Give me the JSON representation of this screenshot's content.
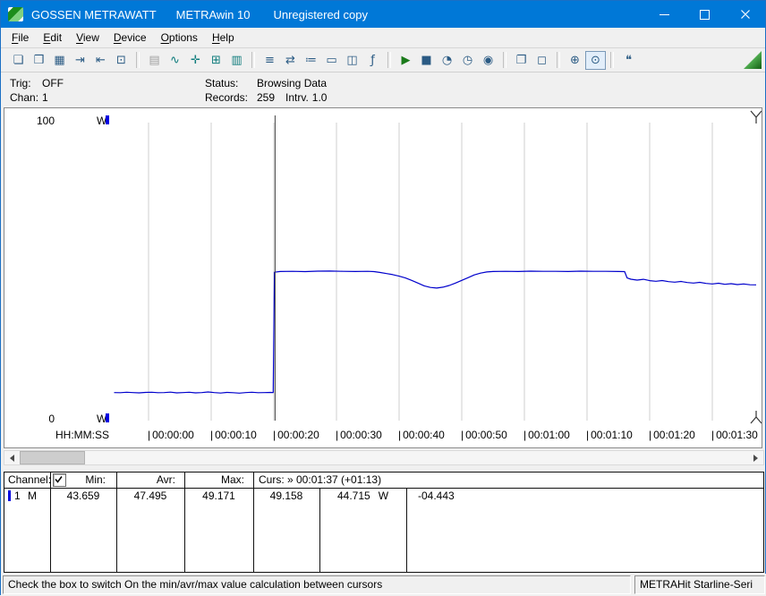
{
  "titlebar": {
    "app": "GOSSEN METRAWATT",
    "product": "METRAwin 10",
    "license": "Unregistered copy"
  },
  "menu": {
    "items": [
      "File",
      "Edit",
      "View",
      "Device",
      "Options",
      "Help"
    ]
  },
  "toolbar": {
    "buttons": [
      {
        "name": "new-file",
        "glyph": "❏"
      },
      {
        "name": "open-file",
        "glyph": "❒"
      },
      {
        "name": "save-file",
        "glyph": "▦"
      },
      {
        "name": "export-data",
        "glyph": "⇥"
      },
      {
        "name": "import-data",
        "glyph": "⇤"
      },
      {
        "name": "copy-data",
        "glyph": "⊡"
      },
      {
        "name": "print-list",
        "glyph": "▤"
      },
      {
        "name": "view-trend",
        "glyph": "∿"
      },
      {
        "name": "view-xy",
        "glyph": "✛"
      },
      {
        "name": "view-table",
        "glyph": "⊞"
      },
      {
        "name": "view-bargraph",
        "glyph": "▥"
      },
      {
        "name": "channel-config",
        "glyph": "≡"
      },
      {
        "name": "device-connect",
        "glyph": "⇄"
      },
      {
        "name": "measure-settings",
        "glyph": "≔"
      },
      {
        "name": "display-monitor",
        "glyph": "▭"
      },
      {
        "name": "live-display",
        "glyph": "◫"
      },
      {
        "name": "formula",
        "glyph": "ƒ"
      },
      {
        "name": "start-recording",
        "glyph": "▶"
      },
      {
        "name": "stop-recording",
        "glyph": "■"
      },
      {
        "name": "trigger-clock",
        "glyph": "◔"
      },
      {
        "name": "interval-timer",
        "glyph": "◷"
      },
      {
        "name": "duration",
        "glyph": "◉"
      },
      {
        "name": "print",
        "glyph": "❐"
      },
      {
        "name": "print-preview",
        "glyph": "◻"
      },
      {
        "name": "zoom-in",
        "glyph": "⊕"
      },
      {
        "name": "zoom-mode",
        "glyph": "⊙"
      },
      {
        "name": "notes",
        "glyph": "❝"
      }
    ]
  },
  "panel": {
    "trig_label": "Trig:",
    "trig_value": "OFF",
    "chan_label": "Chan:",
    "chan_value": "1",
    "status_label": "Status:",
    "status_value": "Browsing Data",
    "records_label": "Records:",
    "records_value": "259",
    "intrv_label": "Intrv.",
    "intrv_value": "1.0"
  },
  "chart_data": {
    "type": "line",
    "title": "",
    "y_axis": {
      "unit": "W",
      "min": 0,
      "max": 100
    },
    "x_axis": {
      "format": "HH:MM:SS",
      "ticks_s": [
        0,
        10,
        20,
        30,
        40,
        50,
        60,
        70,
        80,
        90
      ],
      "tick_labels": [
        "00:00:00",
        "00:00:10",
        "00:00:20",
        "00:00:30",
        "00:00:40",
        "00:00:50",
        "00:01:00",
        "00:01:10",
        "00:01:20",
        "00:01:30"
      ],
      "view_start_s": -5.5,
      "view_end_s": 97.9
    },
    "cursors": {
      "cursor1_s": 20.2,
      "cursor2_s": 97,
      "cursor2_time": "00:01:37",
      "delta_time": "+01:13",
      "value_at_cursor1_w": 49.158,
      "value_at_cursor2_w": 44.715,
      "delta_w": -4.443
    },
    "stats_between_cursors": {
      "min_w": 43.659,
      "avr_w": 47.495,
      "max_w": 49.171
    },
    "series": [
      {
        "name": "Channel 1",
        "unit": "W",
        "color": "#0000cc",
        "points": [
          [
            -5.5,
            9.0
          ],
          [
            -4.5,
            8.95
          ],
          [
            -3.5,
            9.1
          ],
          [
            -2.5,
            9.0
          ],
          [
            -1.5,
            8.9
          ],
          [
            -0.5,
            9.05
          ],
          [
            0.5,
            9.1
          ],
          [
            1.5,
            8.95
          ],
          [
            2.5,
            9.0
          ],
          [
            3.5,
            9.15
          ],
          [
            4.5,
            8.9
          ],
          [
            5.5,
            9.0
          ],
          [
            6.5,
            9.1
          ],
          [
            7.5,
            8.9
          ],
          [
            8.5,
            9.0
          ],
          [
            9.5,
            9.2
          ],
          [
            10.5,
            9.0
          ],
          [
            11.5,
            8.85
          ],
          [
            12.5,
            9.05
          ],
          [
            13.5,
            8.95
          ],
          [
            14.5,
            8.8
          ],
          [
            15.5,
            9.0
          ],
          [
            16.5,
            9.1
          ],
          [
            17.5,
            8.95
          ],
          [
            18.5,
            9.0
          ],
          [
            19.5,
            9.05
          ],
          [
            19.9,
            9.0
          ],
          [
            20.1,
            48.9
          ],
          [
            21,
            49.15
          ],
          [
            23,
            49.2
          ],
          [
            25,
            49.1
          ],
          [
            27,
            49.25
          ],
          [
            29,
            49.3
          ],
          [
            31,
            49.2
          ],
          [
            33,
            49.15
          ],
          [
            35,
            49.2
          ],
          [
            36,
            49.1
          ],
          [
            37,
            48.8
          ],
          [
            38,
            48.45
          ],
          [
            39,
            48.1
          ],
          [
            40,
            47.6
          ],
          [
            41,
            47.0
          ],
          [
            42,
            46.2
          ],
          [
            43,
            45.3
          ],
          [
            44,
            44.4
          ],
          [
            45,
            43.85
          ],
          [
            46,
            43.66
          ],
          [
            47,
            43.95
          ],
          [
            48,
            44.5
          ],
          [
            49,
            45.3
          ],
          [
            50,
            46.2
          ],
          [
            51,
            47.1
          ],
          [
            52,
            48.0
          ],
          [
            53,
            48.6
          ],
          [
            54,
            49.0
          ],
          [
            55,
            49.15
          ],
          [
            57,
            49.2
          ],
          [
            59,
            49.15
          ],
          [
            61,
            49.25
          ],
          [
            63,
            49.2
          ],
          [
            65,
            49.2
          ],
          [
            67,
            49.15
          ],
          [
            69,
            49.25
          ],
          [
            71,
            49.2
          ],
          [
            73,
            49.2
          ],
          [
            75,
            49.15
          ],
          [
            76,
            49.1
          ],
          [
            76.4,
            47.0
          ],
          [
            77,
            46.6
          ],
          [
            78,
            46.3
          ],
          [
            79,
            46.55
          ],
          [
            80,
            46.1
          ],
          [
            81,
            45.9
          ],
          [
            82,
            46.15
          ],
          [
            83,
            45.8
          ],
          [
            84,
            45.6
          ],
          [
            85,
            45.85
          ],
          [
            86,
            45.5
          ],
          [
            87,
            45.3
          ],
          [
            88,
            45.55
          ],
          [
            89,
            45.2
          ],
          [
            90,
            45.0
          ],
          [
            91,
            45.25
          ],
          [
            92,
            44.9
          ],
          [
            93,
            45.1
          ],
          [
            94,
            44.8
          ],
          [
            95,
            45.0
          ],
          [
            96,
            44.75
          ],
          [
            97,
            44.715
          ]
        ]
      }
    ]
  },
  "table": {
    "channel_header": "Channel:",
    "min_header": "Min:",
    "avr_header": "Avr:",
    "max_header": "Max:",
    "curs_header": "Curs: » 00:01:37 (+01:13)",
    "checkbox_checked": true,
    "row": {
      "channel": "1",
      "mode": "M",
      "min": "43.659",
      "avr": "47.495",
      "max": "49.171",
      "cursor1": "49.158",
      "cursor2": "44.715",
      "unit": "W",
      "delta": "-04.443"
    }
  },
  "statusbar": {
    "left": "Check the box to switch On the min/avr/max value calculation between cursors",
    "right": "METRAHit Starline-Seri"
  }
}
